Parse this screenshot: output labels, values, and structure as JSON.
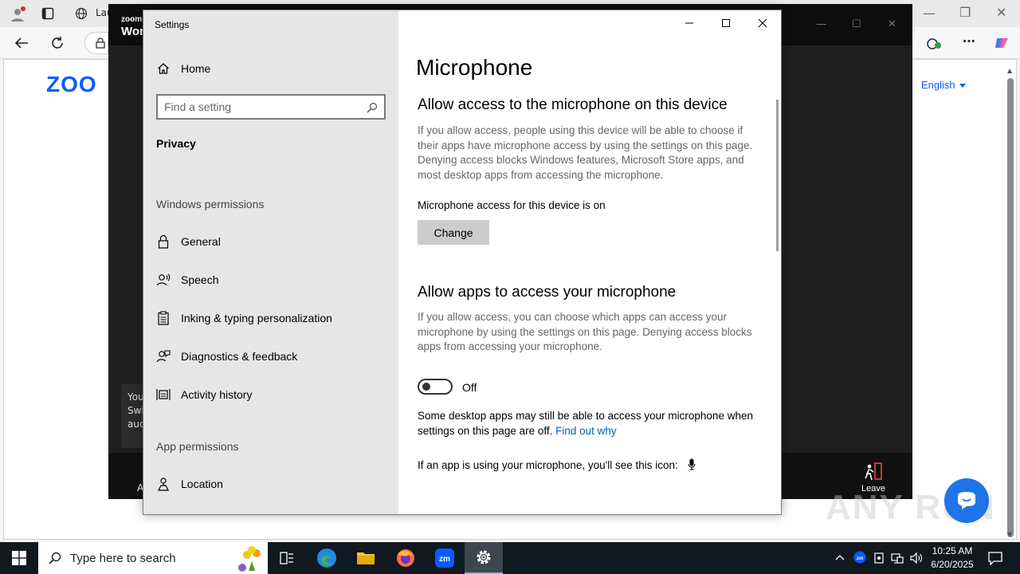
{
  "browser": {
    "tab_label": "Lau",
    "language": "English",
    "page_logo": "ZOO"
  },
  "zoom": {
    "title_small": "zoom",
    "title_big": "Wor",
    "toast_lines": [
      "You",
      "Swi",
      "auc"
    ],
    "bottom_left_text": "A",
    "leave_label": "Leave"
  },
  "settings": {
    "window_title": "Settings",
    "sidebar": {
      "home_label": "Home",
      "search_placeholder": "Find a setting",
      "category": "Privacy",
      "windows_permissions_header": "Windows permissions",
      "items": [
        {
          "label": "General",
          "icon": "lock-icon"
        },
        {
          "label": "Speech",
          "icon": "speech-icon"
        },
        {
          "label": "Inking & typing personalization",
          "icon": "clipboard-icon"
        },
        {
          "label": "Diagnostics & feedback",
          "icon": "diagnostics-icon"
        },
        {
          "label": "Activity history",
          "icon": "activity-history-icon"
        }
      ],
      "app_permissions_header": "App permissions",
      "app_items": [
        {
          "label": "Location",
          "icon": "location-icon"
        }
      ]
    },
    "content": {
      "page_title": "Microphone",
      "section1": {
        "heading": "Allow access to the microphone on this device",
        "description": "If you allow access, people using this device will be able to choose if their apps have microphone access by using the settings on this page. Denying access blocks Windows features, Microsoft Store apps, and most desktop apps from accessing the microphone.",
        "status": "Microphone access for this device is on",
        "change_label": "Change"
      },
      "section2": {
        "heading": "Allow apps to access your microphone",
        "description": "If you allow access, you can choose which apps can access your microphone by using the settings on this page. Denying access blocks apps from accessing your microphone.",
        "toggle_state": "Off",
        "note": "Some desktop apps may still be able to access your microphone when settings on this page are off.",
        "link": "Find out why",
        "icon_note": "If an app is using your microphone, you'll see this icon:"
      }
    }
  },
  "taskbar": {
    "search_placeholder": "Type here to search",
    "time": "10:25 AM",
    "date": "6/20/2025"
  },
  "watermark": "ANY RUN"
}
